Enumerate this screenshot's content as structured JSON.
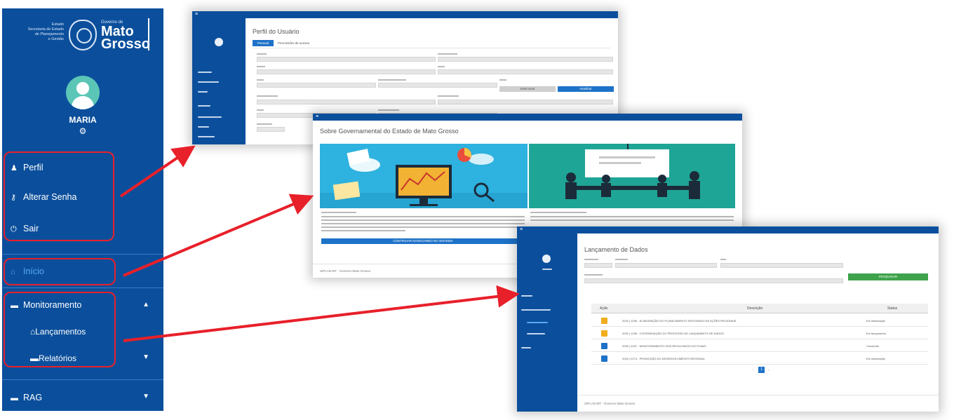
{
  "sidebar": {
    "logo": {
      "dept_lines": [
        "Estado",
        "Secretaria de Estado",
        "de Planejamento",
        "e Gestão"
      ],
      "gov_small": "Governo de",
      "gov_line1": "Mato",
      "gov_line2": "Grosso"
    },
    "user_name": "MARIA",
    "menu": {
      "perfil": "Perfil",
      "alterar_senha": "Alterar Senha",
      "sair": "Sair",
      "inicio": "Início",
      "monitoramento": "Monitoramento",
      "lancamentos": "Lançamentos",
      "relatorios": "Relatórios",
      "rag": "RAG"
    },
    "icons": {
      "perfil": "user-icon",
      "alterar_senha": "key-icon",
      "sair": "power-icon",
      "inicio": "home-icon",
      "monitoramento": "folder-icon",
      "lancamentos": "home-icon",
      "relatorios": "folder-icon",
      "rag": "folder-icon"
    }
  },
  "profile_window": {
    "title": "Perfil do Usuário",
    "tab_active": "Pessoal",
    "tab_other": "Permissões de acesso",
    "button_grey": "Selecionar",
    "button_blue": "Atualizar"
  },
  "home_window": {
    "title": "Sobre Governamental do Estado de Mato Grosso",
    "button": "CONTINUAR NAVEGANDO NO SISTEMA",
    "footer": "SIPLAN-MT - Governo Mato Grosso"
  },
  "launch_window": {
    "title": "Lançamento de Dados",
    "filter_button": "PESQUISAR",
    "table_headers": [
      "Ação",
      "Descrição",
      "Status"
    ],
    "rows": [
      {
        "action": "edit",
        "description": "2020 | 1036 - ELABORAÇÃO DO PLANEJAMENTO INTEGRADO DE AÇÕES REGIONAIS",
        "status": "Em elaboração"
      },
      {
        "action": "edit",
        "description": "2020 | 1036 - COORDENAÇÃO DO PROCESSO DE LANÇAMENTO DE DADOS",
        "status": "Em lançamento"
      },
      {
        "action": "view",
        "description": "2020 | 1037 - MONITORAMENTO DOS RESULTADOS DO PLANO",
        "status": "Concluído"
      },
      {
        "action": "view",
        "description": "2020 | 2274 - PROMOÇÃO DO DESENVOLVIMENTO REGIONAL",
        "status": "Em elaboração"
      }
    ],
    "page": "1",
    "footer": "SIPLAN-MT - Governo Mato Grosso"
  },
  "colors": {
    "brand_blue": "#0b4f9c",
    "highlight_red": "#e8202a",
    "avatar_teal": "#5cc6b6",
    "button_blue": "#1e72c8",
    "button_green": "#3ea34b",
    "action_yellow": "#f0ad1e"
  }
}
